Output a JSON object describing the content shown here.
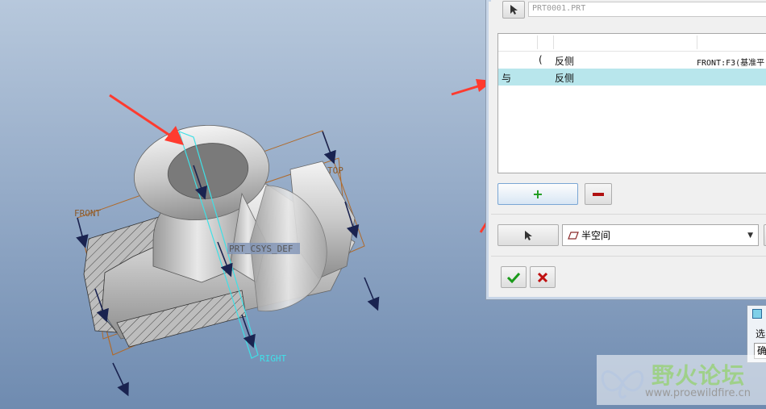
{
  "viewport": {
    "plane_labels": {
      "front": "FRONT",
      "top": "TOP",
      "right": "RIGHT",
      "csys": "PRT_CSYS_DEF"
    }
  },
  "dialog": {
    "reference_field": "PRT0001.PRT",
    "rows": [
      {
        "op": "",
        "paren": "(",
        "side": "反侧",
        "reference": "FRONT:F3(基准平"
      },
      {
        "op": "与",
        "paren": "",
        "side": "反侧",
        "reference": ""
      }
    ],
    "add_label": "+",
    "remove_label": "−",
    "type_select": {
      "value": "半空间",
      "icon": "half-space-icon"
    },
    "ok_icon": "checkmark-icon",
    "cancel_icon": "x-icon"
  },
  "mini_window": {
    "label": "选",
    "field": "确"
  },
  "watermark": {
    "title": "野火论坛",
    "url": "www.proewildfire.cn"
  },
  "colors": {
    "add": "#1a9a1a",
    "remove": "#b01010",
    "ok": "#1a9a1a",
    "cancel": "#c01010",
    "highlight": "#b8e6ec",
    "arrow": "#ff3b2f"
  }
}
